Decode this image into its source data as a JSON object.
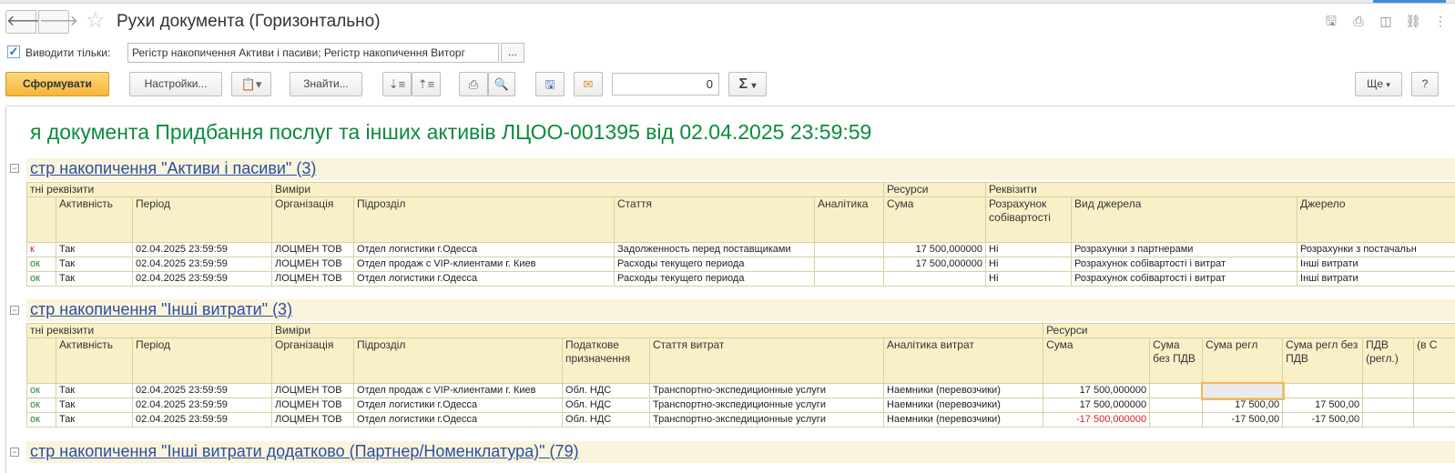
{
  "window": {
    "title": "Рухи документа (Горизонтально)"
  },
  "filter": {
    "checkbox_label": "Виводити тільки:",
    "value": "Регістр накопичення Активи і пасиви; Регістр накопичення Виторг",
    "more": "..."
  },
  "toolbar": {
    "generate": "Сформувати",
    "settings": "Настройки...",
    "find": "Знайти...",
    "number": "0",
    "sigma": "Σ",
    "more": "Ще",
    "help": "?"
  },
  "report": {
    "title": "я документа Придбання послуг та інших активів ЛЦОО-001395 від 02.04.2025 23:59:59",
    "sections": [
      {
        "heading": "стр накопичення \"Активи і пасиви\" (3)",
        "groups": [
          "тні реквізити",
          "Виміри",
          "Ресурси",
          "Реквізити"
        ],
        "columns": [
          "",
          "Активність",
          "Період",
          "Організація",
          "Підрозділ",
          "Стаття",
          "Аналітика",
          "Сума",
          "Розрахунок собівартості",
          "Вид джерела",
          "Джерело"
        ],
        "rows": [
          [
            "к",
            "Так",
            "02.04.2025 23:59:59",
            "ЛОЦМЕН ТОВ",
            "Отдел логистики г.Одесса",
            "Задолженность перед поставщиками",
            "",
            "17 500,000000",
            "Ні",
            "Розрахунки з партнерами",
            "Розрахунки з постачальн"
          ],
          [
            "ок",
            "Так",
            "02.04.2025 23:59:59",
            "ЛОЦМЕН ТОВ",
            "Отдел продаж с  VIP-клиентами г. Киев",
            "Расходы текущего периода",
            "",
            "17 500,000000",
            "Ні",
            "Розрахунок собівартості і витрат",
            "Інші витрати"
          ],
          [
            "ок",
            "Так",
            "02.04.2025 23:59:59",
            "ЛОЦМЕН ТОВ",
            "Отдел логистики г.Одесса",
            "Расходы текущего периода",
            "",
            "",
            "Ні",
            "Розрахунок собівартості і витрат",
            "Інші витрати"
          ]
        ]
      },
      {
        "heading": "стр накопичення \"Інші витрати\" (3)",
        "groups": [
          "тні реквізити",
          "Виміри",
          "Ресурси"
        ],
        "columns": [
          "",
          "Активність",
          "Період",
          "Організація",
          "Підрозділ",
          "Податкове призначення",
          "Стаття витрат",
          "Аналітика витрат",
          "Сума",
          "Сума без ПДВ",
          "Сума регл",
          "Сума регл без ПДВ",
          "ПДВ (регл.)",
          "(в С"
        ],
        "rows": [
          [
            "ок",
            "Так",
            "02.04.2025 23:59:59",
            "ЛОЦМЕН ТОВ",
            "Отдел продаж с  VIP-клиентами г. Киев",
            "Обл. НДС",
            "Транспортно-экспедиционные услуги",
            "Наемники (перевозчики)",
            "17 500,000000",
            "",
            "",
            "",
            "",
            ""
          ],
          [
            "ок",
            "Так",
            "02.04.2025 23:59:59",
            "ЛОЦМЕН ТОВ",
            "Отдел логистики г.Одесса",
            "Обл. НДС",
            "Транспортно-экспедиционные услуги",
            "Наемники (перевозчики)",
            "17 500,000000",
            "",
            "17 500,00",
            "17 500,00",
            "",
            ""
          ],
          [
            "ок",
            "Так",
            "02.04.2025 23:59:59",
            "ЛОЦМЕН ТОВ",
            "Отдел логистики г.Одесса",
            "Обл. НДС",
            "Транспортно-экспедиционные услуги",
            "Наемники (перевозчики)",
            "-17 500,000000",
            "",
            "-17 500,00",
            "-17 500,00",
            "",
            ""
          ]
        ]
      },
      {
        "heading": "стр накопичення \"Інші витрати додатково (Партнер/Номенклатура)\" (79)"
      }
    ]
  },
  "colors": {
    "accent": "#f5b63a",
    "title_green": "#0c8b3c",
    "link_blue": "#2a4ea0",
    "header_bg": "#faf0c8",
    "negative": "#d42222"
  }
}
